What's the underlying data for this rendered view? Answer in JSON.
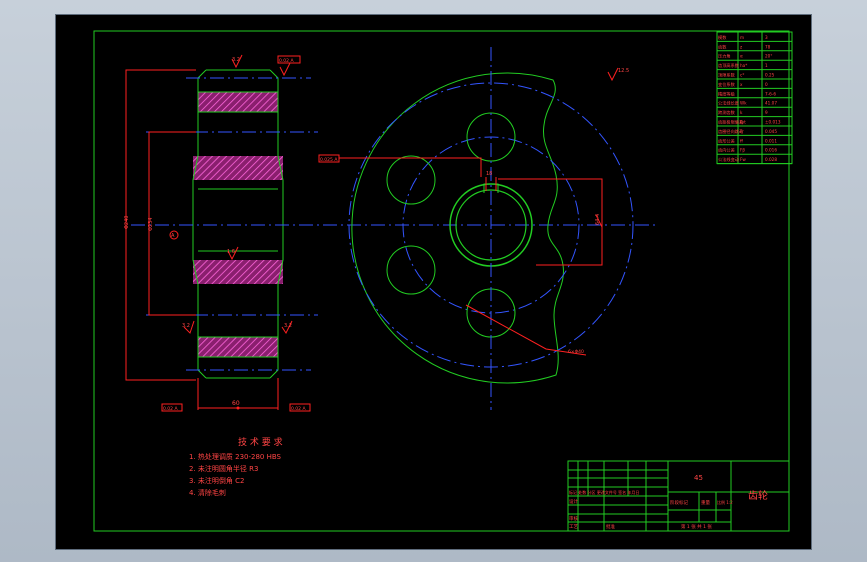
{
  "drawing": {
    "title_block": {
      "part_name": "齿轮",
      "material": "45",
      "scale_label": "比例 1:2",
      "sheet_label": "第 1 张 共 1 张",
      "weight_label": "重量",
      "designer_label": "设计",
      "checker_label": "审核",
      "process_label": "工艺",
      "approve_label": "批准",
      "stage_label": "阶段标记",
      "change_label": "标记 处数 分区 更改文件号 签名 年月日"
    },
    "tech_requirements": {
      "heading": "技 术 要 求",
      "items": [
        "1. 热处理调质 230-280 HBS",
        "2. 未注明圆角半径 R3",
        "3. 未注明倒角 C2",
        "4. 清除毛刺"
      ]
    },
    "parameter_table": {
      "rows": [
        [
          "模数",
          "m",
          "3"
        ],
        [
          "齿数",
          "z",
          "78"
        ],
        [
          "压力角",
          "α",
          "20°"
        ],
        [
          "齿顶高系数",
          "ha*",
          "1"
        ],
        [
          "顶隙系数",
          "c*",
          "0.25"
        ],
        [
          "变位系数",
          "x",
          "0"
        ],
        [
          "精度等级",
          "",
          "7-6-6"
        ],
        [
          "公法线长度",
          "Wk",
          "41.07"
        ],
        [
          "跨测齿数",
          "k",
          "9"
        ],
        [
          "齿距极限偏差",
          "fpt",
          "±0.013"
        ],
        [
          "齿圈径向跳动",
          "Fr",
          "0.045"
        ],
        [
          "齿形公差",
          "ff",
          "0.011"
        ],
        [
          "齿向公差",
          "Fβ",
          "0.016"
        ],
        [
          "公法线变动",
          "Fw",
          "0.028"
        ]
      ]
    },
    "annotations": {
      "roughness_top": "3.2",
      "roughness_corner": "12.5",
      "roughness_bore": "1.6",
      "roughness_side_left": "3.2",
      "roughness_side_right": "3.2",
      "datum_tol_top": "0.02 A",
      "datum_tol_keyway": "0.025 A",
      "face_width_tol": "0.02 A",
      "face_width_tol_right": "0.02 A",
      "width_dim": "60",
      "od_dim": "Φ240",
      "pitch_dim": "Φ234",
      "hub_dim": "Φ120",
      "bore_dim": "Φ60",
      "keyway_depth": "64.4",
      "keyway_width": "18",
      "hole_note": "6×Φ40",
      "datum_letter": "A"
    }
  }
}
